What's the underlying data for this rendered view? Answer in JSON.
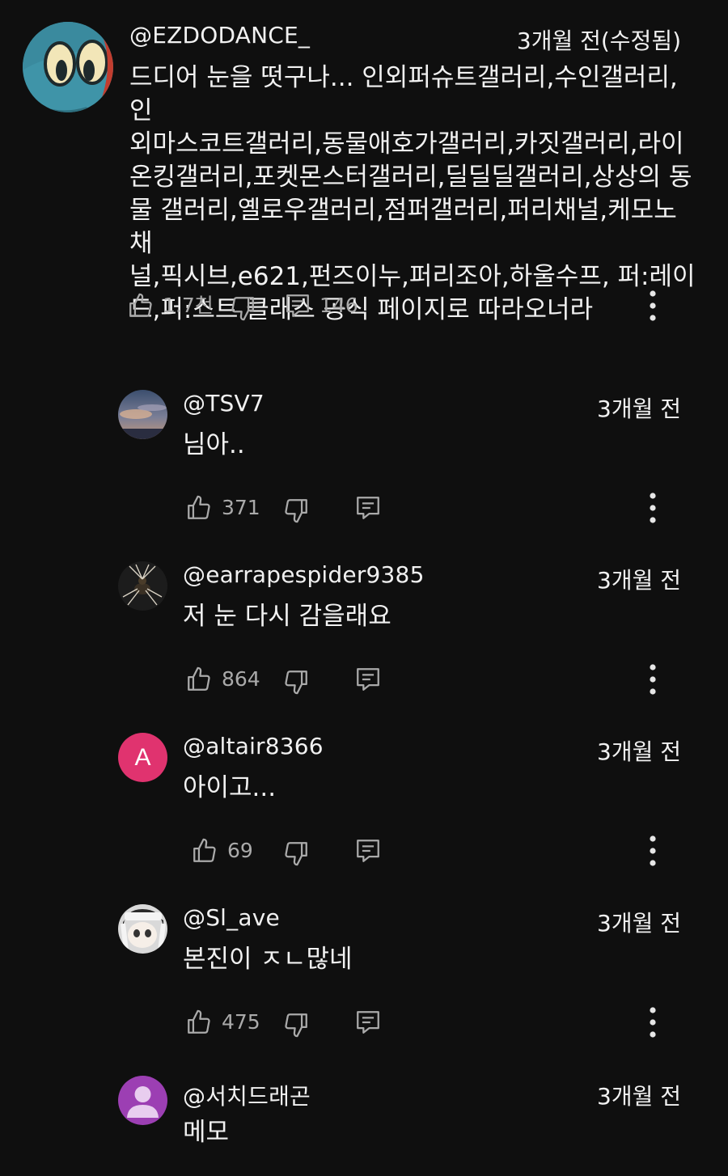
{
  "top_comment": {
    "handle": "@EZDODANCE_",
    "time": "3개월 전(수정됨)",
    "text": "드디어 눈을 떳구나... 인외퍼슈트갤러리,수인갤러리,인\n외마스코트갤러리,동물애호가갤러리,카짓갤러리,라이\n온킹갤러리,포켓몬스터갤러리,딜딜딜갤러리,상상의 동\n물 갤러리,옐로우갤러리,점퍼갤러리,퍼리채널,케모노채\n널,픽시브,e621,펀즈이누,퍼리조아,하울수프, 퍼:레이\n드,퍼:스트 클래스 공식 페이지로 따라오너라",
    "likes": "1.7천",
    "replies": "146",
    "avatar_icon": "cartoon-character-avatar"
  },
  "replies": [
    {
      "handle": "@TSV7",
      "time": "3개월 전",
      "text": "님아..",
      "likes": "371",
      "avatar_icon": "sky-photo-avatar"
    },
    {
      "handle": "@earrapespider9385",
      "time": "3개월 전",
      "text": "저 눈 다시 감을래요",
      "likes": "864",
      "avatar_icon": "spider-avatar"
    },
    {
      "handle": "@altair8366",
      "time": "3개월 전",
      "text": "아이고...",
      "likes": "69",
      "avatar_letter": "A",
      "avatar_color": "#e0336f"
    },
    {
      "handle": "@Sl_ave",
      "time": "3개월 전",
      "text": "본진이 ㅈㄴ많네",
      "likes": "475",
      "avatar_icon": "anime-character-avatar"
    },
    {
      "handle": "@서치드래곤",
      "time": "3개월 전",
      "text": "메모",
      "avatar_icon": "default-person-avatar",
      "avatar_color": "#9c3fb3"
    }
  ],
  "colors": {
    "background": "#0f0f0f",
    "text": "#f1f1f1",
    "secondary_text": "#aaaaaa",
    "icon": "#aaaaaa"
  }
}
